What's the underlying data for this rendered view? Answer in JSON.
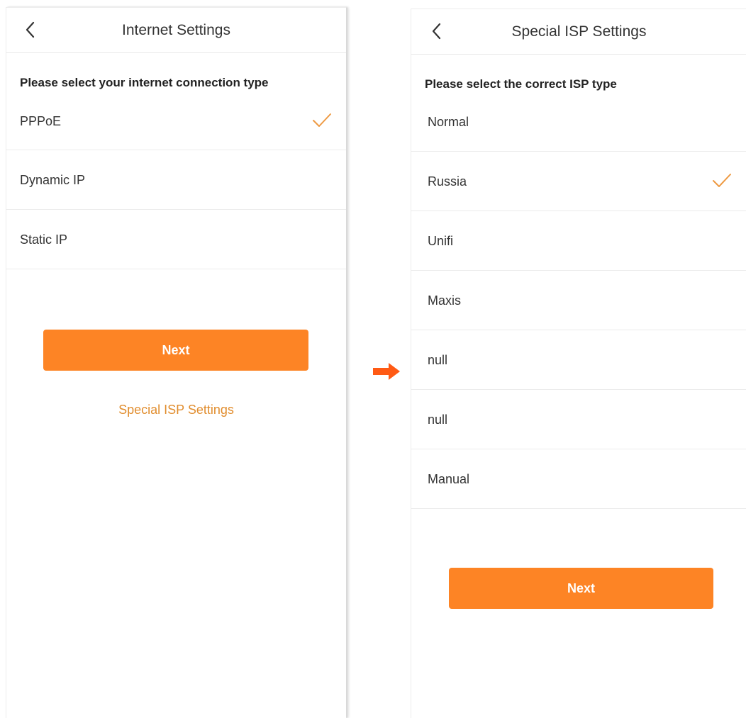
{
  "accent_color": "#fd8425",
  "left_screen": {
    "title": "Internet Settings",
    "back_icon": "chevron-left-icon",
    "prompt": "Please select your internet connection type",
    "options": [
      {
        "label": "PPPoE",
        "selected": true
      },
      {
        "label": "Dynamic IP",
        "selected": false
      },
      {
        "label": "Static IP",
        "selected": false
      }
    ],
    "next_label": "Next",
    "special_isp_link": "Special ISP Settings"
  },
  "flow_arrow_icon": "arrow-right-icon",
  "right_screen": {
    "title": "Special ISP Settings",
    "back_icon": "chevron-left-icon",
    "prompt": "Please select the correct ISP type",
    "options": [
      {
        "label": "Normal",
        "selected": false
      },
      {
        "label": "Russia",
        "selected": true
      },
      {
        "label": "Unifi",
        "selected": false
      },
      {
        "label": "Maxis",
        "selected": false
      },
      {
        "label": "null",
        "selected": false
      },
      {
        "label": "null",
        "selected": false
      },
      {
        "label": "Manual",
        "selected": false
      }
    ],
    "next_label": "Next"
  }
}
